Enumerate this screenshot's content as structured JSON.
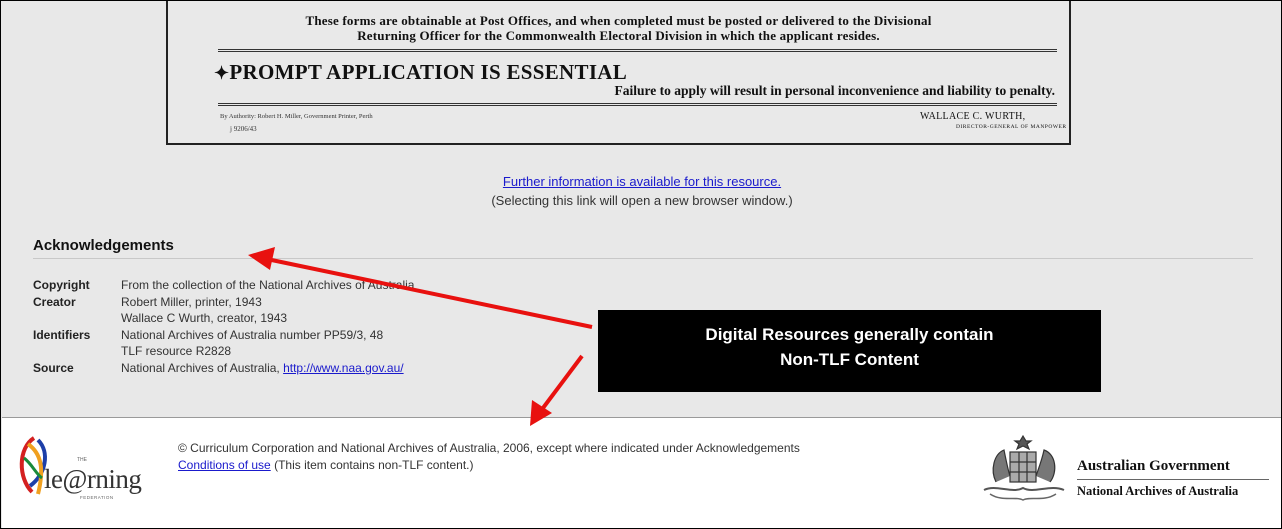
{
  "document": {
    "line1": "These forms are obtainable at Post Offices, and when completed must be posted or delivered to the Divisional",
    "line2": "Returning Officer for the Commonwealth Electoral Division in which the applicant resides.",
    "prompt": "PROMPT APPLICATION IS ESSENTIAL",
    "failure": "Failure to apply will result in personal inconvenience and liability to penalty.",
    "authority": "By Authority: Robert H. Miller, Government Printer, Perth",
    "ref": "j 9206/43",
    "signatory": "WALLACE C. WURTH,",
    "signatory_title": "DIRECTOR-GENERAL OF MANPOWER"
  },
  "further": {
    "link": "Further information is available for this resource.",
    "note": "(Selecting this link will open a new browser window.)"
  },
  "ack": {
    "heading": "Acknowledgements",
    "rows": [
      {
        "label": "Copyright",
        "lines": [
          "From the collection of the National Archives of Australia"
        ]
      },
      {
        "label": "Creator",
        "lines": [
          "Robert Miller, printer, 1943",
          "Wallace C Wurth, creator, 1943"
        ]
      },
      {
        "label": "Identifiers",
        "lines": [
          "National Archives of Australia number PP59/3, 48",
          "TLF resource R2828"
        ]
      },
      {
        "label": "Source",
        "text": "National Archives of Australia, ",
        "link": "http://www.naa.gov.au/"
      }
    ]
  },
  "callout": {
    "line1": "Digital Resources generally contain",
    "line2": "Non-TLF Content"
  },
  "footer": {
    "copyright": "© Curriculum Corporation and National Archives of Australia, 2006, except where indicated under Acknowledgements",
    "conditions_link": "Conditions of use",
    "conditions_note": " (This item contains non-TLF content.)",
    "tlf_logo_word": "le@rning",
    "tlf_logo_top": "THE",
    "tlf_logo_bottom": "FEDERATION",
    "ag_title": "Australian Government",
    "ag_sub": "National Archives of Australia"
  },
  "icons": [
    "tlf-logo",
    "commonwealth-crest-icon",
    "red-arrow-annotation"
  ],
  "colors": {
    "link": "#1a1acc",
    "arrow": "#e8110f",
    "callout_bg": "#000000"
  }
}
